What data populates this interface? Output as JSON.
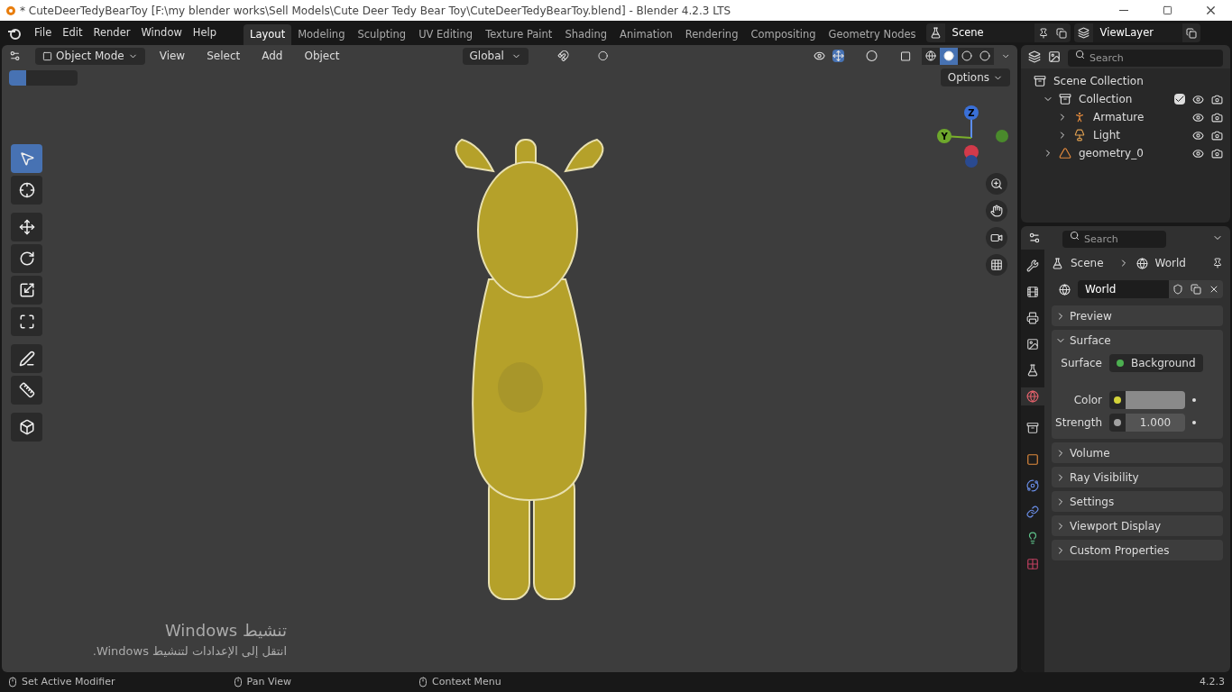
{
  "title_bar": {
    "title": "* CuteDeerTedyBearToy [F:\\my blender works\\Sell Models\\Cute Deer Tedy Bear Toy\\CuteDeerTedyBearToy.blend] - Blender 4.2.3 LTS"
  },
  "menu": [
    "File",
    "Edit",
    "Render",
    "Window",
    "Help"
  ],
  "workspaces": [
    {
      "label": "Layout",
      "selected": true
    },
    {
      "label": "Modeling",
      "selected": false
    },
    {
      "label": "Sculpting",
      "selected": false
    },
    {
      "label": "UV Editing",
      "selected": false
    },
    {
      "label": "Texture Paint",
      "selected": false
    },
    {
      "label": "Shading",
      "selected": false
    },
    {
      "label": "Animation",
      "selected": false
    },
    {
      "label": "Rendering",
      "selected": false
    },
    {
      "label": "Compositing",
      "selected": false
    },
    {
      "label": "Geometry Nodes",
      "selected": false
    }
  ],
  "scene": "Scene",
  "view_layer": "ViewLayer",
  "viewport": {
    "mode": "Object Mode",
    "menus": [
      "View",
      "Select",
      "Add",
      "Object"
    ],
    "orientation": "Global",
    "options": "Options",
    "gizmo_axes": [
      "Z",
      "Y"
    ],
    "shading": [
      {
        "kind": "wireframe",
        "selected": false
      },
      {
        "kind": "solid",
        "selected": true
      },
      {
        "kind": "material",
        "selected": false
      },
      {
        "kind": "rendered",
        "selected": false
      }
    ],
    "tools": [
      {
        "kind": "select",
        "selected": true
      },
      {
        "kind": "cursor",
        "selected": false
      },
      {
        "kind": "move",
        "selected": false
      },
      {
        "kind": "rotate",
        "selected": false
      },
      {
        "kind": "scale",
        "selected": false
      },
      {
        "kind": "transform",
        "selected": false
      },
      {
        "kind": "annotate",
        "selected": false
      },
      {
        "kind": "measure",
        "selected": false
      },
      {
        "kind": "add-cube",
        "selected": false
      }
    ]
  },
  "activation": {
    "title": "تنشيط Windows",
    "message": "انتقل إلى الإعدادات لتنشيط Windows."
  },
  "outliner": {
    "search_placeholder": "Search",
    "items": [
      {
        "label": "Scene Collection",
        "kind": "scene-collection",
        "children": [
          {
            "label": "Collection",
            "kind": "collection",
            "expanded": true,
            "children": [
              {
                "label": "Armature",
                "kind": "armature",
                "expanded": false
              },
              {
                "label": "Light",
                "kind": "light",
                "expanded": false
              }
            ]
          },
          {
            "label": "geometry_0",
            "kind": "mesh",
            "expanded": false
          }
        ]
      }
    ]
  },
  "properties": {
    "search_placeholder": "Search",
    "breadcrumb": [
      "Scene",
      "World"
    ],
    "datablock": "World",
    "tabs": [
      {
        "kind": "tool",
        "selected": false
      },
      {
        "kind": "render",
        "selected": false
      },
      {
        "kind": "output",
        "selected": false
      },
      {
        "kind": "view-layer",
        "selected": false
      },
      {
        "kind": "scene",
        "selected": false
      },
      {
        "kind": "world",
        "selected": true
      },
      {
        "kind": "collection",
        "selected": false
      },
      {
        "kind": "object",
        "selected": false
      },
      {
        "kind": "physics",
        "selected": false
      },
      {
        "kind": "constraints",
        "selected": false
      },
      {
        "kind": "data",
        "selected": false
      },
      {
        "kind": "texture",
        "selected": false
      }
    ],
    "panels": [
      {
        "label": "Preview",
        "expanded": false
      },
      {
        "label": "Surface",
        "expanded": true,
        "fields": [
          {
            "label": "Surface",
            "kind": "shader",
            "value": "Background",
            "color": "#4caf50"
          },
          {
            "label": "Color",
            "kind": "color",
            "color": "#d4d43a"
          },
          {
            "label": "Strength",
            "kind": "number",
            "value": "1.000",
            "color": "#a0a0a0"
          }
        ]
      },
      {
        "label": "Volume",
        "expanded": false
      },
      {
        "label": "Ray Visibility",
        "expanded": false
      },
      {
        "label": "Settings",
        "expanded": false
      },
      {
        "label": "Viewport Display",
        "expanded": false
      },
      {
        "label": "Custom Properties",
        "expanded": false
      }
    ]
  },
  "status_bar": {
    "hints": [
      "Set Active Modifier",
      "Pan View",
      "Context Menu"
    ],
    "version": "4.2.3"
  }
}
